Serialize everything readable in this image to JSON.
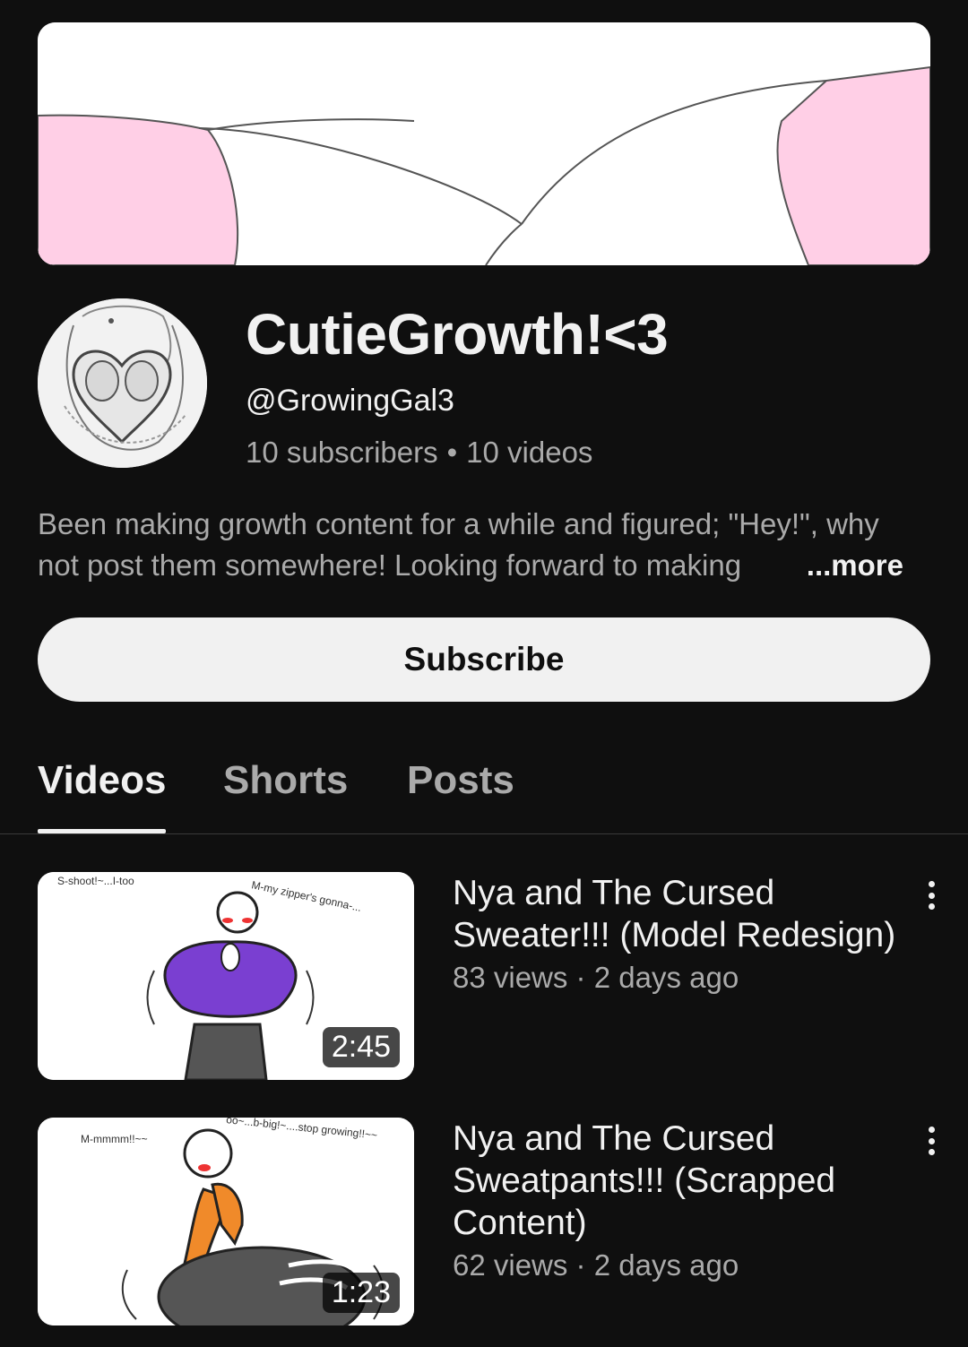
{
  "channel": {
    "name": "CutieGrowth!<3",
    "handle": "@GrowingGal3",
    "subscribers": "10 subscribers",
    "videos_count": "10 videos",
    "separator": "•",
    "description_line1": "Been making growth content for a while and figured; \"Hey!\", why",
    "description_line2": "not post them somewhere! Looking forward to making",
    "more_label": "...more"
  },
  "subscribe_label": "Subscribe",
  "tabs": [
    {
      "label": "Videos",
      "active": true
    },
    {
      "label": "Shorts",
      "active": false
    },
    {
      "label": "Posts",
      "active": false
    }
  ],
  "videos": [
    {
      "title": "Nya and The Cursed Sweater!!! (Model Redesign)",
      "meta": "83 views · 2 days ago",
      "duration": "2:45",
      "thumb_text_1": "S-shoot!~...I-too",
      "thumb_text_2": "M-my zipper's gonna-..."
    },
    {
      "title": "Nya and The Cursed Sweatpants!!! (Scrapped Content)",
      "meta": "62 views · 2 days ago",
      "duration": "1:23",
      "thumb_text_1": "M-mmmm!!~~",
      "thumb_text_2": "oo~...b-big!~....stop growing!!~~"
    }
  ],
  "colors": {
    "background": "#0f0f0f",
    "text_primary": "#f1f1f1",
    "text_secondary": "#aaaaaa",
    "banner_pink": "#ffcfe6"
  }
}
